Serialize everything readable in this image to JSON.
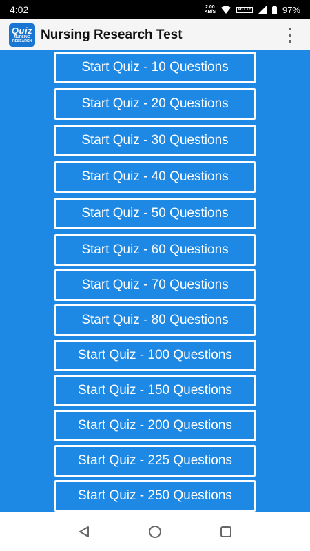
{
  "status": {
    "time": "4:02",
    "net_speed_value": "2.00",
    "net_speed_unit": "KB/S",
    "volte": "Vo LTE",
    "battery": "97%"
  },
  "appbar": {
    "logo_text": "Quiz",
    "logo_sub": "NURSING RESEARCH",
    "title": "Nursing Research Test"
  },
  "quizzes": [
    {
      "label": "Start Quiz - 10 Questions"
    },
    {
      "label": "Start Quiz - 20 Questions"
    },
    {
      "label": "Start Quiz - 30 Questions"
    },
    {
      "label": "Start Quiz - 40 Questions"
    },
    {
      "label": "Start Quiz - 50 Questions"
    },
    {
      "label": "Start Quiz - 60 Questions"
    },
    {
      "label": "Start Quiz - 70 Questions"
    },
    {
      "label": "Start Quiz - 80 Questions"
    },
    {
      "label": "Start Quiz - 100 Questions"
    },
    {
      "label": "Start Quiz - 150 Questions"
    },
    {
      "label": "Start Quiz - 200 Questions"
    },
    {
      "label": "Start Quiz - 225 Questions"
    },
    {
      "label": "Start Quiz - 250 Questions"
    }
  ],
  "colors": {
    "accent": "#1e88e5",
    "status_bar": "#000000",
    "app_bar": "#f5f5f5"
  },
  "icons": {
    "back": "back-icon",
    "home": "home-icon",
    "recents": "recents-icon",
    "menu": "overflow-menu-icon"
  }
}
